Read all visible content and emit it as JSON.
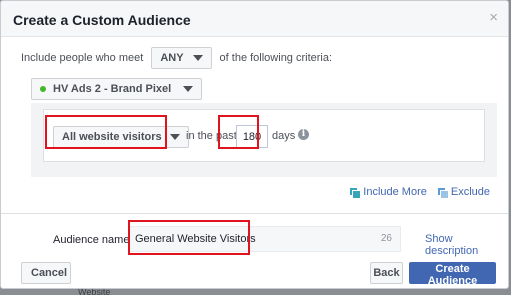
{
  "dialog": {
    "title": "Create a Custom Audience",
    "close_glyph": "×"
  },
  "criteria": {
    "prefix": "Include people who meet",
    "match_value": "ANY",
    "suffix": "of the following criteria:"
  },
  "pixel": {
    "name": "HV Ads 2 - Brand Pixel",
    "status_color": "#42b72a"
  },
  "rule": {
    "visitors_value": "All website visitors",
    "in_the_past_label": "in the past",
    "days_value": "180",
    "days_label": "days",
    "info_glyph": "i"
  },
  "links": {
    "include_more": "Include More",
    "exclude": "Exclude"
  },
  "audience": {
    "label": "Audience name",
    "value": "General Website Visitors",
    "char_counter": "26",
    "show_description": "Show description"
  },
  "footer": {
    "cancel": "Cancel",
    "back": "Back",
    "create": "Create Audience"
  },
  "backdrop": {
    "text": "Website"
  },
  "colors": {
    "accent": "#4267b2",
    "highlight": "#e0141e"
  }
}
